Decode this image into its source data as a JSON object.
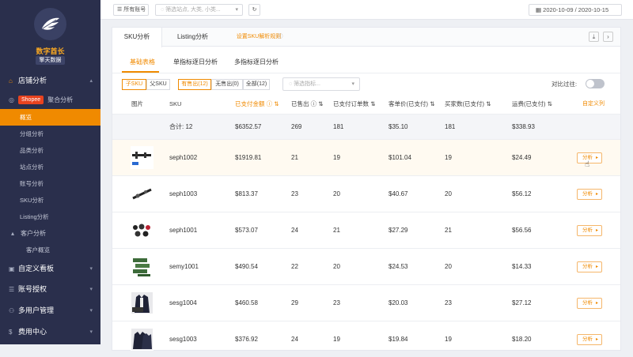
{
  "brand": {
    "name": "数字酋长",
    "sub": "擎天数据"
  },
  "sidebar": {
    "store": "店铺分析",
    "shopee_badge": "Shopee",
    "aggregate": "聚合分析",
    "items": [
      "概览",
      "分组分析",
      "品类分析",
      "站点分析",
      "账号分析",
      "SKU分析",
      "Listing分析"
    ],
    "customer": "客户分析",
    "customer_overview": "客户概览",
    "custom_board": "自定义看板",
    "account_auth": "账号授权",
    "multi_user": "多用户管理",
    "billing": "费用中心"
  },
  "topbar": {
    "accounts": "所有账号",
    "filter_placeholder": "筛选站点, 大类, 小类...",
    "date_range": "2020-10-09 / 2020-10-15"
  },
  "tabs": {
    "sku": "SKU分析",
    "listing": "Listing分析",
    "rule": "设置SKU解析规则"
  },
  "subtabs": [
    "基础表格",
    "单指标逐日分析",
    "多指标逐日分析"
  ],
  "filters": {
    "child": "子SKU",
    "parent": "父SKU",
    "sold": "有售出(12)",
    "unsold": "无售出(0)",
    "all": "全部(12)",
    "metric_placeholder": "筛选指标...",
    "compare": "对比过往:"
  },
  "columns": {
    "image": "图片",
    "sku": "SKU",
    "paid_amount": "已支付金额",
    "sold": "已售出",
    "orders": "已支付订单数",
    "unit_price": "客单价(已支付)",
    "buyers": "买家数(已支付)",
    "shipping": "运费(已支付)",
    "custom": "自定义列"
  },
  "total": {
    "label": "合计: 12",
    "paid_amount": "$6352.57",
    "sold": "269",
    "orders": "181",
    "unit_price": "$35.10",
    "buyers": "181",
    "shipping": "$338.93"
  },
  "analyze_label": "分析",
  "rows": [
    {
      "sku": "seph1002",
      "paid_amount": "$1919.81",
      "sold": "21",
      "orders": "19",
      "unit_price": "$101.04",
      "buyers": "19",
      "shipping": "$24.49"
    },
    {
      "sku": "seph1003",
      "paid_amount": "$813.37",
      "sold": "23",
      "orders": "20",
      "unit_price": "$40.67",
      "buyers": "20",
      "shipping": "$56.12"
    },
    {
      "sku": "seph1001",
      "paid_amount": "$573.07",
      "sold": "24",
      "orders": "21",
      "unit_price": "$27.29",
      "buyers": "21",
      "shipping": "$56.56"
    },
    {
      "sku": "semy1001",
      "paid_amount": "$490.54",
      "sold": "22",
      "orders": "20",
      "unit_price": "$24.53",
      "buyers": "20",
      "shipping": "$14.33"
    },
    {
      "sku": "sesg1004",
      "paid_amount": "$460.58",
      "sold": "29",
      "orders": "23",
      "unit_price": "$20.03",
      "buyers": "23",
      "shipping": "$27.12"
    },
    {
      "sku": "sesg1003",
      "paid_amount": "$376.92",
      "sold": "24",
      "orders": "19",
      "unit_price": "$19.84",
      "buyers": "19",
      "shipping": "$18.20"
    }
  ],
  "colors": {
    "sidebar": "#2a2f4c",
    "accent": "#f08a00",
    "shopee": "#e8431f"
  }
}
